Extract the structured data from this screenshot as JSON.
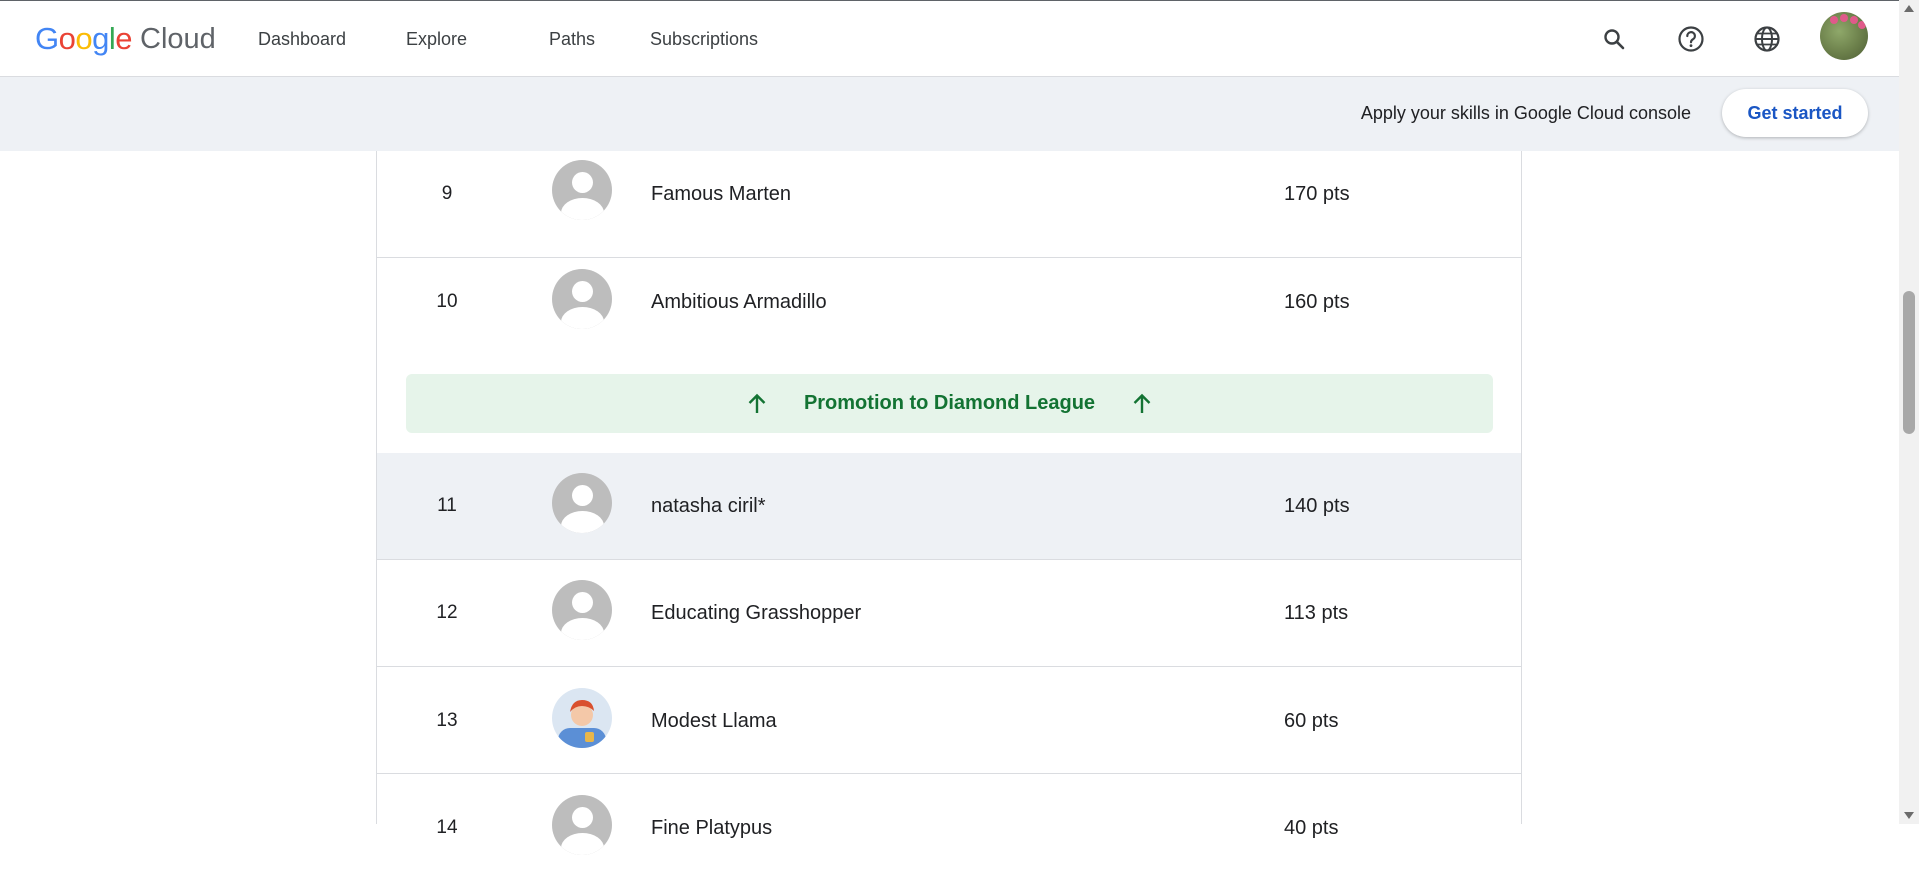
{
  "header": {
    "logo_google": "Google",
    "logo_cloud": "Cloud",
    "nav": [
      "Dashboard",
      "Explore",
      "Paths",
      "Subscriptions"
    ],
    "icons": [
      "search-icon",
      "help-icon",
      "language-icon"
    ]
  },
  "promo": {
    "text": "Apply your skills in Google Cloud console",
    "button": "Get started"
  },
  "leaderboard": {
    "rows_top": [
      {
        "rank": "9",
        "name": "Famous Marten",
        "points": "170 pts"
      },
      {
        "rank": "10",
        "name": "Ambitious Armadillo",
        "points": "160 pts"
      }
    ],
    "promotion_label": "Promotion to Diamond League",
    "rows_bottom": [
      {
        "rank": "11",
        "name": "natasha ciril*",
        "points": "140 pts",
        "current_user": true
      },
      {
        "rank": "12",
        "name": "Educating Grasshopper",
        "points": "113 pts"
      },
      {
        "rank": "13",
        "name": "Modest Llama",
        "points": "60 pts"
      },
      {
        "rank": "14",
        "name": "Fine Platypus",
        "points": "40 pts"
      }
    ]
  },
  "colors": {
    "promo_band": "#eef1f5",
    "promotion_bg": "#e6f4ea",
    "promotion_text": "#137333",
    "link_blue": "#1a56c4"
  }
}
